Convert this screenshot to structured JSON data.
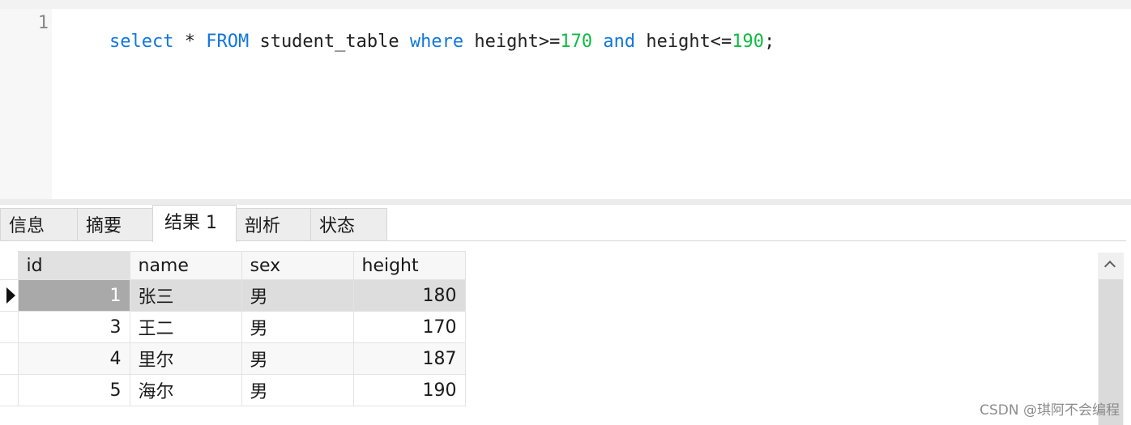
{
  "editor": {
    "line_number": "1",
    "tokens": [
      {
        "text": "select",
        "kind": "kw"
      },
      {
        "text": " * ",
        "kind": "id"
      },
      {
        "text": "FROM",
        "kind": "kw"
      },
      {
        "text": " student_table ",
        "kind": "id"
      },
      {
        "text": "where",
        "kind": "kw"
      },
      {
        "text": " height>=",
        "kind": "id"
      },
      {
        "text": "170",
        "kind": "num"
      },
      {
        "text": " ",
        "kind": "id"
      },
      {
        "text": "and",
        "kind": "kw"
      },
      {
        "text": " height<=",
        "kind": "id"
      },
      {
        "text": "190",
        "kind": "num"
      },
      {
        "text": ";",
        "kind": "id"
      }
    ],
    "colors": {
      "keyword": "#1177dd",
      "number": "#11bb44",
      "identifier": "#222222"
    }
  },
  "tabs": [
    {
      "label": "信息",
      "active": false
    },
    {
      "label": "摘要",
      "active": false
    },
    {
      "label": "结果 1",
      "active": true
    },
    {
      "label": "剖析",
      "active": false
    },
    {
      "label": "状态",
      "active": false
    }
  ],
  "grid": {
    "columns": [
      "id",
      "name",
      "sex",
      "height"
    ],
    "rows": [
      {
        "id": "1",
        "name": "张三",
        "sex": "男",
        "height": "180",
        "selected": true
      },
      {
        "id": "3",
        "name": "王二",
        "sex": "男",
        "height": "170",
        "selected": false
      },
      {
        "id": "4",
        "name": "里尔",
        "sex": "男",
        "height": "187",
        "selected": false
      },
      {
        "id": "5",
        "name": "海尔",
        "sex": "男",
        "height": "190",
        "selected": false
      }
    ]
  },
  "watermark": "CSDN @琪阿不会编程"
}
